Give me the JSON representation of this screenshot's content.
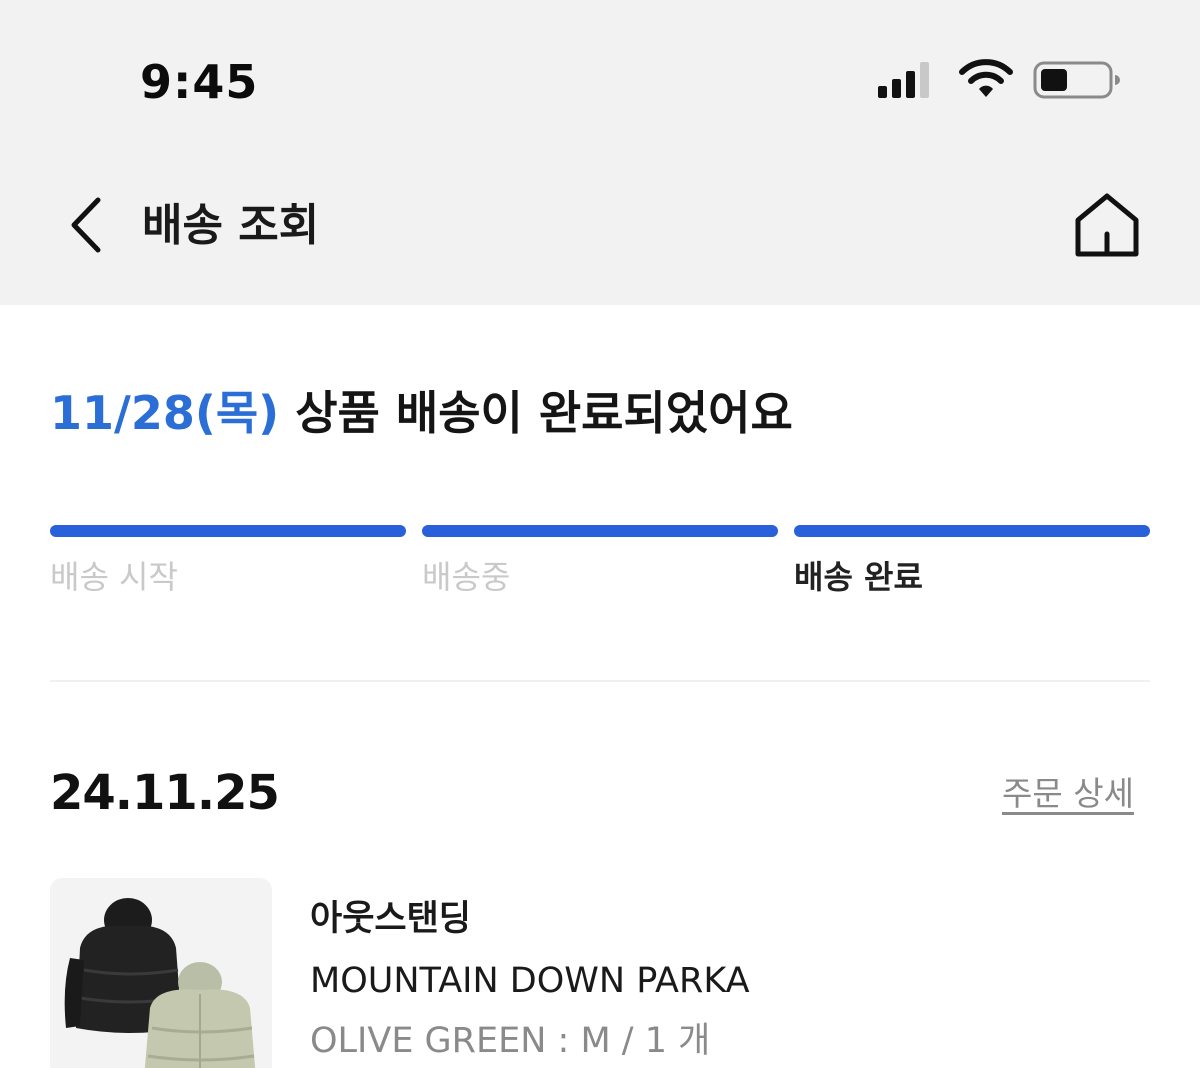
{
  "status_bar": {
    "time": "9:45",
    "icons": [
      "signal-icon",
      "wifi-icon",
      "battery-icon"
    ]
  },
  "header": {
    "title": "배송 조회",
    "back_icon": "chevron-left-icon",
    "home_icon": "home-icon"
  },
  "delivery": {
    "date": "11/28(목)",
    "message": "상품 배송이 완료되었어요",
    "progress": {
      "steps": [
        "배송 시작",
        "배송중",
        "배송 완료"
      ],
      "current_step": 3,
      "total_steps": 3
    }
  },
  "order": {
    "date": "24.11.25",
    "detail_link": "주문 상세",
    "item": {
      "brand": "아웃스탠딩",
      "name": "MOUNTAIN DOWN PARKA",
      "option": "OLIVE GREEN : M / 1 개"
    }
  },
  "colors": {
    "accent_blue": "#2b60db",
    "date_blue": "#2b6fd6",
    "header_bg": "#f2f2f2",
    "muted_text": "#c9c9c9"
  }
}
